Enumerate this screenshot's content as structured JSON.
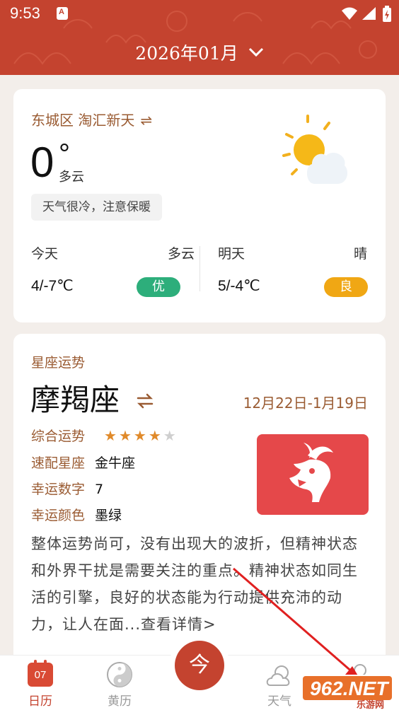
{
  "status_bar": {
    "time": "9:53",
    "notif_glyph": "A"
  },
  "header": {
    "month": "2026年01月"
  },
  "weather": {
    "location": "东城区 淘汇新天",
    "swap_glyph": "⇌",
    "temp": "0",
    "degree": "°",
    "condition": "多云",
    "tip": "天气很冷，注意保暖",
    "today": {
      "label": "今天",
      "condition": "多云",
      "range": "4/-7℃",
      "aqi": "优",
      "aqi_color": "#2dae7b"
    },
    "tomorrow": {
      "label": "明天",
      "condition": "晴",
      "range": "5/-4℃",
      "aqi": "良",
      "aqi_color": "#f0a714"
    }
  },
  "horoscope": {
    "section": "星座运势",
    "sign": "摩羯座",
    "dates": "12月22日-1月19日",
    "rows": [
      {
        "label": "综合运势",
        "value": ""
      },
      {
        "label": "速配星座",
        "value": "金牛座"
      },
      {
        "label": "幸运数字",
        "value": "7"
      },
      {
        "label": "幸运颜色",
        "value": "墨绿"
      }
    ],
    "stars": 4,
    "stars_max": 5,
    "description": "整体运势尚可，没有出现大的波折，但精神状态和外界干扰是需要关注的重点。精神状态如同生活的引擎，良好的状态能为行动提供充沛的动力，让人在面...查看详情>"
  },
  "tabbar": {
    "calendar_day": "07",
    "today_glyph": "今",
    "tabs": [
      {
        "label": "日历"
      },
      {
        "label": "黄历"
      },
      {
        "label": "天气"
      }
    ]
  },
  "watermark": {
    "brand": "962.NET",
    "sub": "乐游网"
  },
  "colors": {
    "accent": "#c4432f",
    "brown": "#9a5b32"
  }
}
